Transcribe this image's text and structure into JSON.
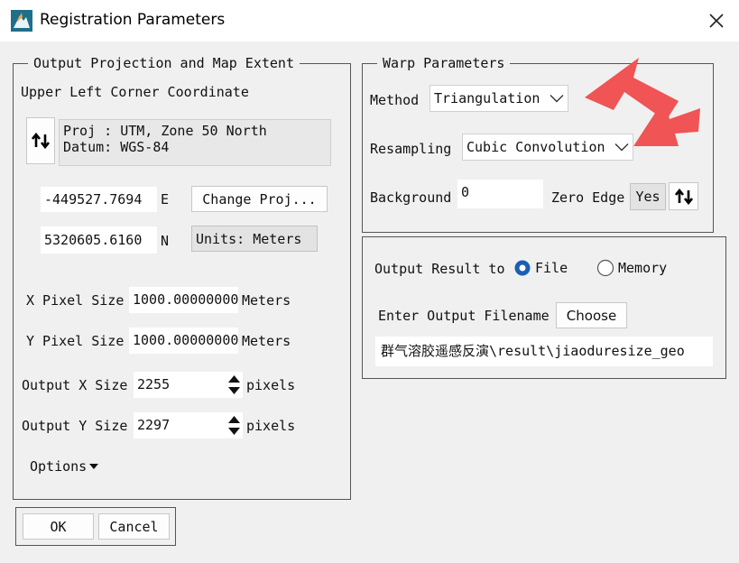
{
  "window": {
    "title": "Registration Parameters"
  },
  "output_group": {
    "legend": "Output Projection and Map Extent",
    "upper_left_label": "Upper Left Corner Coordinate",
    "proj_line1": "Proj : UTM, Zone 50 North",
    "proj_line2": "Datum: WGS-84",
    "easting_value": "-449527.7694",
    "easting_unit": "E",
    "change_proj_label": "Change Proj...",
    "northing_value": "5320605.6160",
    "northing_unit": "N",
    "units_label": "Units: Meters",
    "x_pixel_label": "X Pixel Size",
    "x_pixel_value": "1000.000000000",
    "x_pixel_unit": "Meters",
    "y_pixel_label": "Y Pixel Size",
    "y_pixel_value": "1000.000000000",
    "y_pixel_unit": "Meters",
    "out_x_label": "Output X Size",
    "out_x_value": "2255",
    "out_x_unit": "pixels",
    "out_y_label": "Output Y Size",
    "out_y_value": "2297",
    "out_y_unit": "pixels",
    "options_label": "Options"
  },
  "warp_group": {
    "legend": "Warp Parameters",
    "method_label": "Method",
    "method_value": "Triangulation",
    "resampling_label": "Resampling",
    "resampling_value": "Cubic Convolution",
    "background_label": "Background",
    "background_value": "0",
    "zero_edge_label": "Zero Edge",
    "zero_edge_value": "Yes"
  },
  "result_group": {
    "output_result_label": "Output Result to",
    "file_label": "File",
    "memory_label": "Memory",
    "selected": "File",
    "filename_label": "Enter Output Filename",
    "choose_label": "Choose",
    "filename_value": "群气溶胶遥感反演\\result\\jiaoduresize_geo"
  },
  "footer": {
    "ok_label": "OK",
    "cancel_label": "Cancel"
  },
  "colors": {
    "annotation_arrow": "#f05454",
    "radio_accent": "#1a5fb4"
  }
}
